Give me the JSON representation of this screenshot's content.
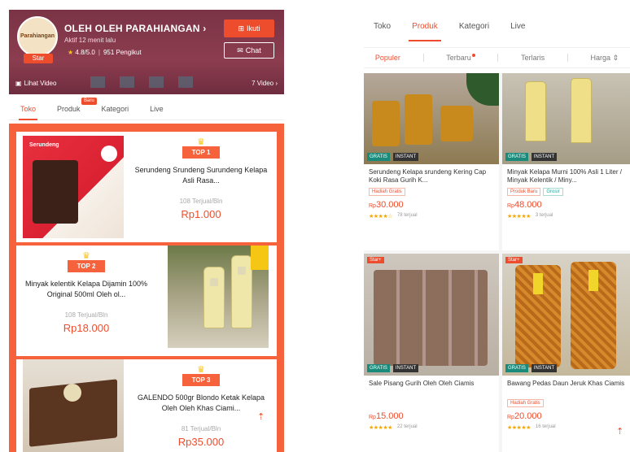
{
  "left": {
    "shop": {
      "logo_text": "Parahiangan",
      "star_label": "Star",
      "name": "OLEH OLEH PARAHIANGAN",
      "subtitle": "Aktif 12 menit lalu",
      "rating": "4.8/5.0",
      "followers": "951 Pengikut",
      "follow_label": "Ikuti",
      "chat_label": "Chat",
      "video_label": "Lihat Video",
      "video_count": "7 Video"
    },
    "tabs": [
      {
        "label": "Toko",
        "active": true
      },
      {
        "label": "Produk",
        "badge": "Baru"
      },
      {
        "label": "Kategori"
      },
      {
        "label": "Live"
      }
    ],
    "top_products": [
      {
        "rank": "TOP 1",
        "title": "Serundeng Srundeng Surundeng Kelapa Asli Rasa...",
        "sold": "108 Terjual/Bln",
        "price": "Rp1.000",
        "img_text": "Serundeng"
      },
      {
        "rank": "TOP 2",
        "title": "Minyak kelentik Kelapa Dijamin 100% Original 500ml Oleh ol...",
        "sold": "108 Terjual/Bln",
        "price": "Rp18.000"
      },
      {
        "rank": "TOP 3",
        "title": "GALENDO 500gr Blondo Ketak Kelapa Oleh Oleh Khas Ciami...",
        "sold": "81 Terjual/Bln",
        "price": "Rp35.000"
      }
    ]
  },
  "right": {
    "tabs": [
      {
        "label": "Toko"
      },
      {
        "label": "Produk",
        "active": true
      },
      {
        "label": "Kategori"
      },
      {
        "label": "Live"
      }
    ],
    "sort": [
      {
        "label": "Populer",
        "active": true
      },
      {
        "label": "Terbaru",
        "dot": true
      },
      {
        "label": "Terlaris"
      },
      {
        "label": "Harga ⇕"
      }
    ],
    "products": [
      {
        "title": "Serundeng Kelapa srundeng Kering Cap Koki Rasa Gurih K...",
        "tags": [
          "Hadiah Gratis"
        ],
        "price": "30.000",
        "rating": "★★★★☆",
        "sold": "78 terjual",
        "strip": [
          "GRATIS",
          "INSTANT"
        ]
      },
      {
        "title": "Minyak Kelapa Murni 100% Asli 1 Liter / Minyak Kelentik / Miny...",
        "tags": [
          "Produk Baru",
          "Grosir"
        ],
        "price": "48.000",
        "rating": "★★★★★",
        "sold": "3 terjual",
        "strip": [
          "GRATIS",
          "INSTANT"
        ]
      },
      {
        "title": "Sale Pisang Gurih Oleh Oleh Ciamis",
        "tags": [],
        "price": "15.000",
        "rating": "★★★★★",
        "sold": "22 terjual",
        "star": "Star+",
        "strip": [
          "GRATIS",
          "INSTANT"
        ]
      },
      {
        "title": "Bawang Pedas Daun Jeruk Khas Ciamis",
        "tags": [
          "Hadiah Gratis"
        ],
        "price": "20.000",
        "rating": "★★★★★",
        "sold": "16 terjual",
        "star": "Star+",
        "strip": [
          "GRATIS",
          "INSTANT"
        ]
      }
    ],
    "currency": "Rp"
  }
}
